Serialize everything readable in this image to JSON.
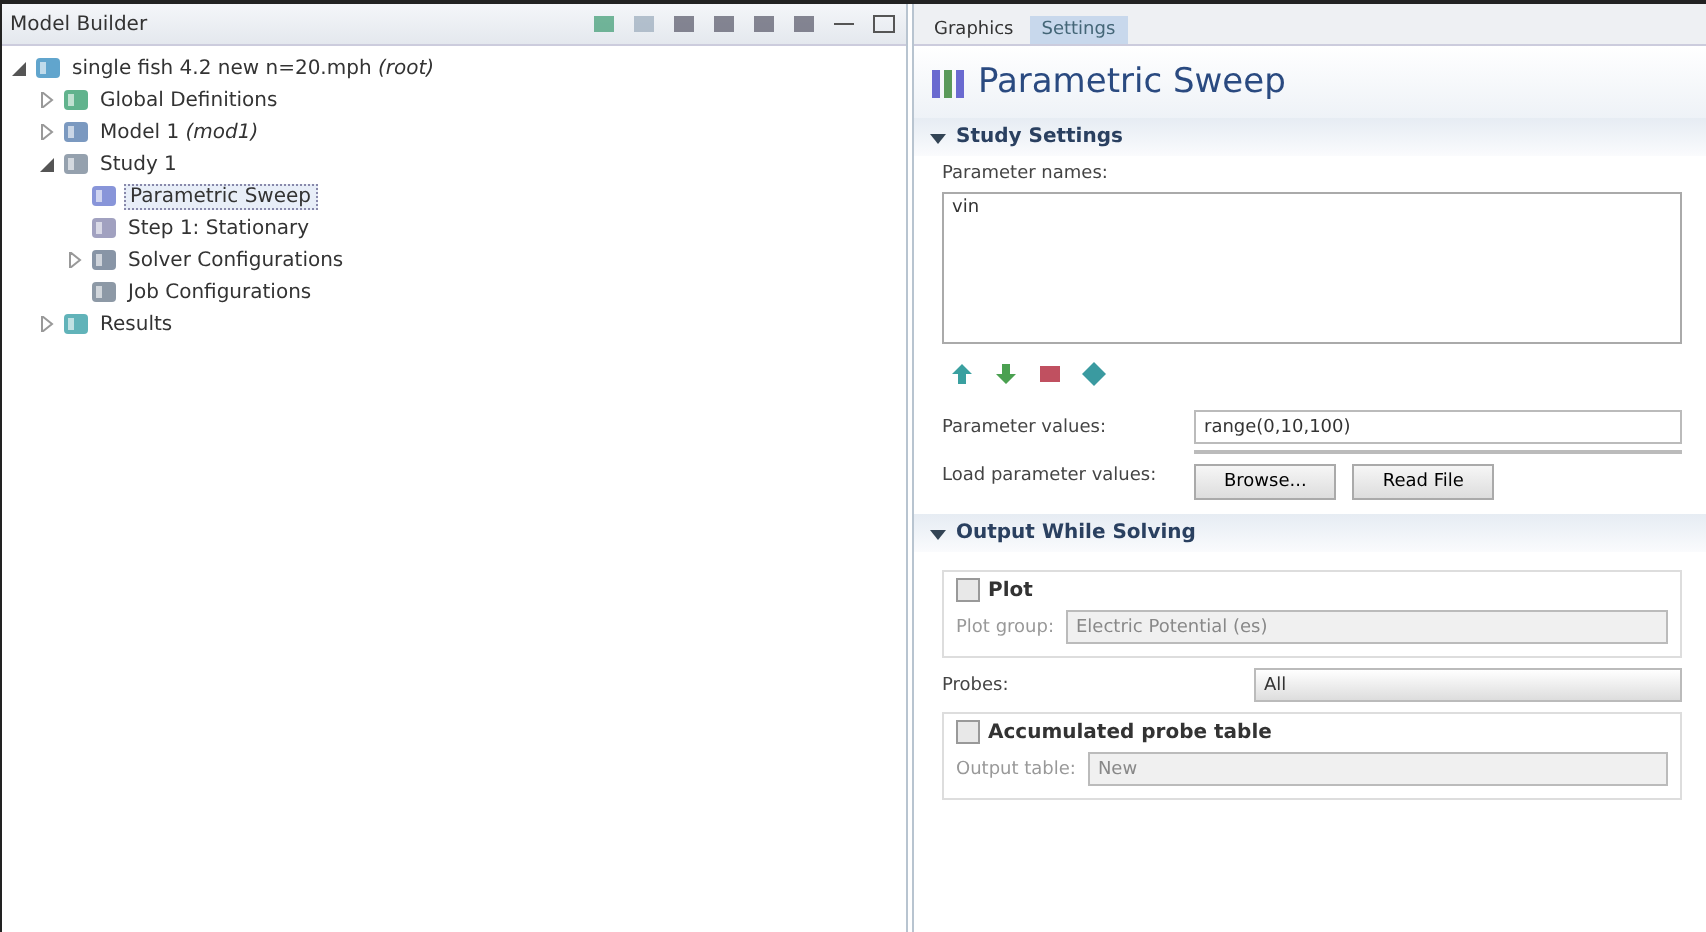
{
  "model_builder": {
    "title": "Model Builder",
    "tree": [
      {
        "label": "single fish 4.2 new n=20.mph *(root)*",
        "kind": "file",
        "expanded": true,
        "selected": false,
        "children": [
          {
            "label": "Global Definitions",
            "kind": "globe",
            "expanded": false,
            "selected": false
          },
          {
            "label": "Model 1 *(mod1)*",
            "kind": "model",
            "expanded": false,
            "selected": false
          },
          {
            "label": "Study 1",
            "kind": "study",
            "expanded": true,
            "selected": false,
            "children": [
              {
                "label": "Parametric Sweep",
                "kind": "sweep",
                "selected": true
              },
              {
                "label": "Step 1: Stationary",
                "kind": "step",
                "selected": false
              },
              {
                "label": "Solver Configurations",
                "kind": "solver",
                "expanded": false,
                "selected": false
              },
              {
                "label": "Job Configurations",
                "kind": "job",
                "selected": false
              }
            ]
          },
          {
            "label": "Results",
            "kind": "results",
            "expanded": false,
            "selected": false
          }
        ]
      }
    ]
  },
  "tabs": [
    {
      "label": "Graphics",
      "selected": false
    },
    {
      "label": "Settings",
      "selected": true
    }
  ],
  "settings": {
    "title": "Parametric Sweep",
    "study_settings": {
      "heading": "Study Settings",
      "expanded": true,
      "parameter_names_label": "Parameter names:",
      "parameter_names": "vin",
      "parameter_values_label": "Parameter values:",
      "parameter_values": "range(0,10,100)",
      "load_label": "Load parameter values:",
      "buttons": [
        "Browse...",
        "Read File"
      ]
    },
    "output": {
      "heading": "Output While Solving",
      "expanded": true,
      "plot": {
        "label": "Plot",
        "checked": false
      },
      "plot_group_label": "Plot group:",
      "plot_group": "Electric Potential (es)",
      "probes_label": "Probes:",
      "probes": "All",
      "probe_table": {
        "label": "Accumulated probe table",
        "checked": false
      },
      "output_table_label": "Output table:",
      "output_table": "New"
    }
  }
}
